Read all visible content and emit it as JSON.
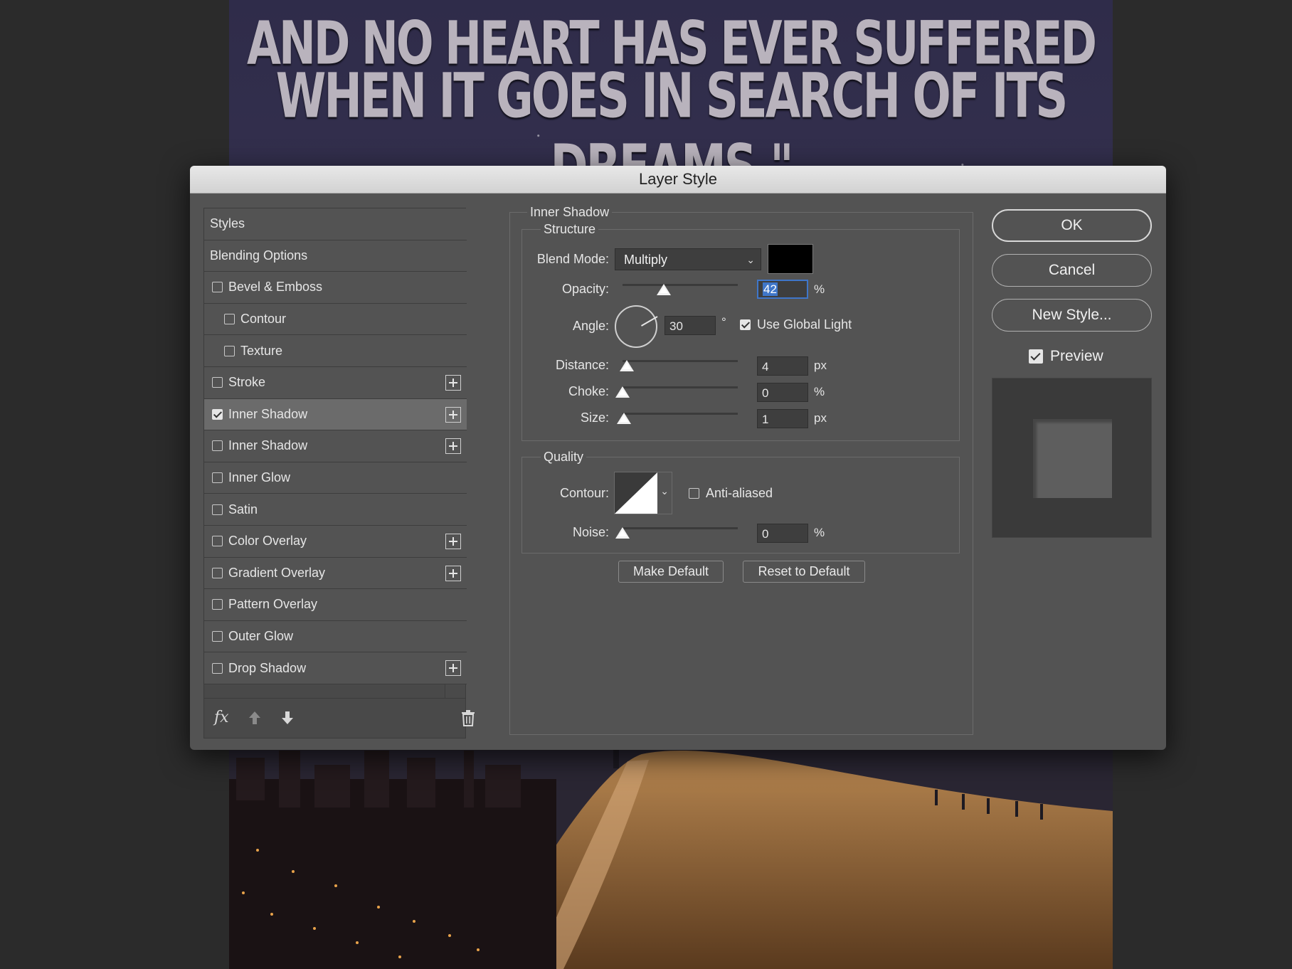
{
  "document": {
    "quote_line_1": "AND NO HEART HAS EVER SUFFERED",
    "quote_line_2": "WHEN IT GOES IN SEARCH OF ITS DREAMS.\""
  },
  "dialog": {
    "title": "Layer Style"
  },
  "styles_panel": {
    "header": "Styles",
    "blending": "Blending Options",
    "items": [
      {
        "label": "Bevel & Emboss",
        "checked": false,
        "add": false,
        "sub": false
      },
      {
        "label": "Contour",
        "checked": false,
        "add": false,
        "sub": true
      },
      {
        "label": "Texture",
        "checked": false,
        "add": false,
        "sub": true
      },
      {
        "label": "Stroke",
        "checked": false,
        "add": true,
        "sub": false
      },
      {
        "label": "Inner Shadow",
        "checked": true,
        "add": true,
        "sub": false,
        "selected": true
      },
      {
        "label": "Inner Shadow",
        "checked": false,
        "add": true,
        "sub": false
      },
      {
        "label": "Inner Glow",
        "checked": false,
        "add": false,
        "sub": false
      },
      {
        "label": "Satin",
        "checked": false,
        "add": false,
        "sub": false
      },
      {
        "label": "Color Overlay",
        "checked": false,
        "add": true,
        "sub": false
      },
      {
        "label": "Gradient Overlay",
        "checked": false,
        "add": true,
        "sub": false
      },
      {
        "label": "Pattern Overlay",
        "checked": false,
        "add": false,
        "sub": false
      },
      {
        "label": "Outer Glow",
        "checked": false,
        "add": false,
        "sub": false
      },
      {
        "label": "Drop Shadow",
        "checked": false,
        "add": true,
        "sub": false
      }
    ],
    "footer": {
      "fx": "fx",
      "up_icon": "arrow-up-icon",
      "down_icon": "arrow-down-icon",
      "trash_icon": "trash-icon"
    }
  },
  "inner_shadow": {
    "group_title": "Inner Shadow",
    "structure_title": "Structure",
    "blend_mode_label": "Blend Mode:",
    "blend_mode_value": "Multiply",
    "shadow_color": "#000000",
    "opacity_label": "Opacity:",
    "opacity_value": "42",
    "opacity_unit": "%",
    "opacity_fraction": 0.42,
    "angle_label": "Angle:",
    "angle_value": "30",
    "angle_unit": "°",
    "use_global_light_label": "Use Global Light",
    "use_global_light": true,
    "distance_label": "Distance:",
    "distance_value": "4",
    "distance_unit": "px",
    "choke_label": "Choke:",
    "choke_value": "0",
    "choke_unit": "%",
    "size_label": "Size:",
    "size_value": "1",
    "size_unit": "px",
    "quality_title": "Quality",
    "contour_label": "Contour:",
    "anti_aliased_label": "Anti-aliased",
    "anti_aliased": false,
    "noise_label": "Noise:",
    "noise_value": "0",
    "noise_unit": "%",
    "make_default": "Make Default",
    "reset_default": "Reset to Default"
  },
  "actions": {
    "ok": "OK",
    "cancel": "Cancel",
    "new_style": "New Style...",
    "preview_label": "Preview",
    "preview": true
  },
  "colors": {
    "dialog_bg": "#535353",
    "focus_blue": "#3f76c9"
  }
}
